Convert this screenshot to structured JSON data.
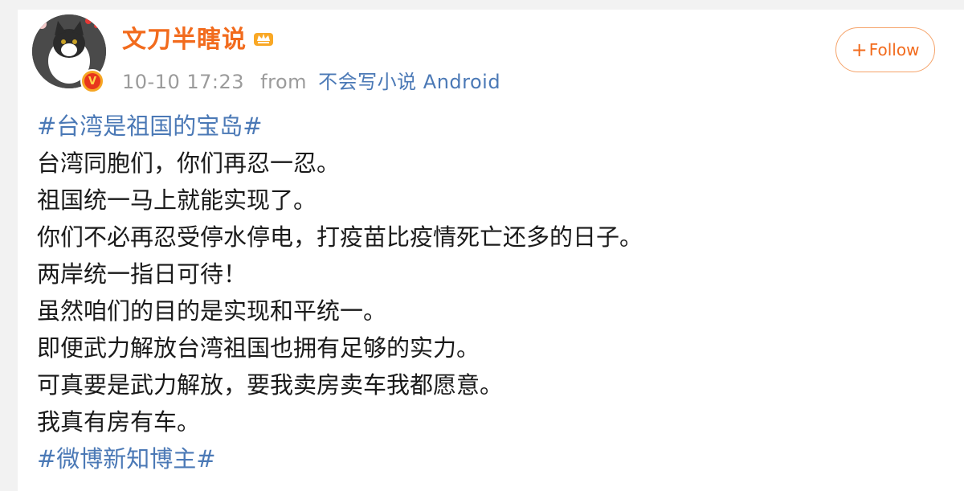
{
  "post": {
    "username": "文刀半瞎说",
    "time": "10-10 17:23",
    "from_label": "from",
    "source": "不会写小说 Android",
    "follow_label": "Follow",
    "follow_prefix": "+",
    "lines": [
      {
        "text": "#台湾是祖国的宝岛#",
        "kind": "hashtag"
      },
      {
        "text": "台湾同胞们，你们再忍一忍。",
        "kind": "text"
      },
      {
        "text": "祖国统一马上就能实现了。",
        "kind": "text"
      },
      {
        "text": "你们不必再忍受停水停电，打疫苗比疫情死亡还多的日子。",
        "kind": "text"
      },
      {
        "text": "两岸统一指日可待！",
        "kind": "text"
      },
      {
        "text": "虽然咱们的目的是实现和平统一。",
        "kind": "text"
      },
      {
        "text": "即便武力解放台湾祖国也拥有足够的实力。",
        "kind": "text"
      },
      {
        "text": "可真要是武力解放，要我卖房卖车我都愿意。",
        "kind": "text"
      },
      {
        "text": "我真有房有车。",
        "kind": "text"
      },
      {
        "text": "#微博新知博主#",
        "kind": "hashtag"
      }
    ]
  },
  "colors": {
    "username": "#f26b1d",
    "hashtag": "#4b79b6",
    "meta": "#9b9b9b",
    "body_text": "#1a1a1a",
    "follow_border": "#f5a36a"
  },
  "icons": {
    "avatar": "cat-avatar",
    "badge": "verified-badge-icon",
    "crown": "crown-icon"
  }
}
